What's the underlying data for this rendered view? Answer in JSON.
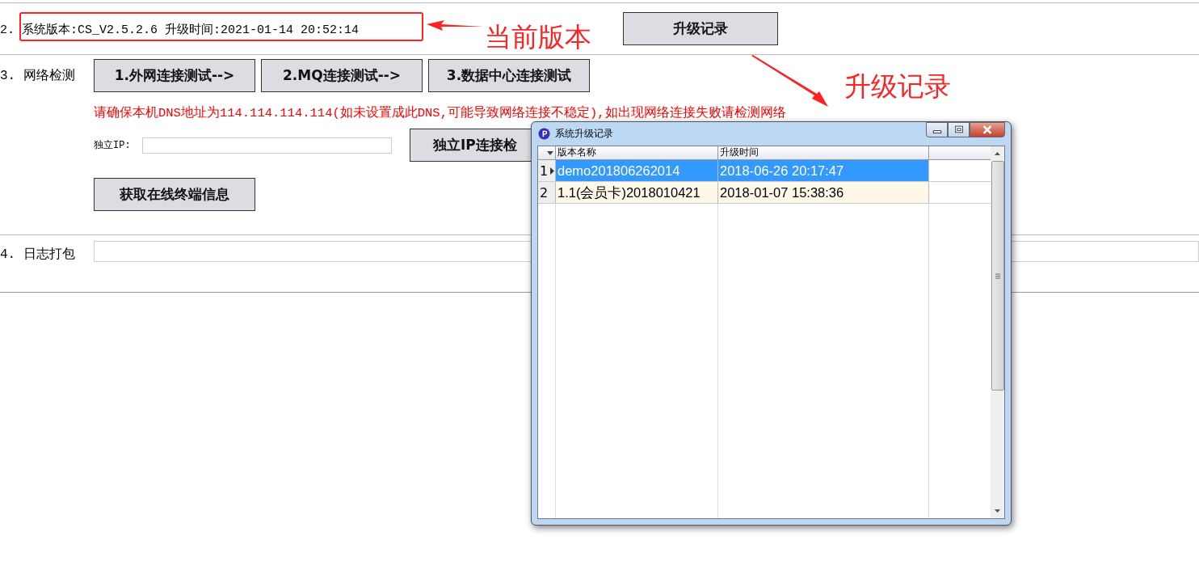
{
  "version_row": {
    "label": "2. 系统版本:CS_V2.5.2.6 升级时间:2021-01-14 20:52:14",
    "button": "升级记录"
  },
  "network": {
    "label": "3. 网络检测",
    "buttons": [
      "1.外网连接测试-->",
      "2.MQ连接测试-->",
      "3.数据中心连接测试"
    ],
    "notice": "请确保本机DNS地址为114.114.114.114(如未设置成此DNS,可能导致网络连接不稳定),如出现网络连接失败请检测网络",
    "ip_label": "独立IP:",
    "ip_button": "独立IP连接检",
    "terminal_button": "获取在线终端信息"
  },
  "log": {
    "label": "4. 日志打包"
  },
  "dialog": {
    "title": "系统升级记录",
    "columns": [
      "版本名称",
      "升级时间"
    ],
    "rows": [
      {
        "number": "1",
        "cells": [
          "demo201806262014",
          "2018-06-26 20:17:47"
        ],
        "selected": true
      },
      {
        "number": "2",
        "cells": [
          "1.1(会员卡)2018010421",
          "2018-01-07 15:38:36"
        ],
        "selected": false
      }
    ]
  },
  "annotations": [
    {
      "kind": "boxed-arrow",
      "text": "当前版本"
    },
    {
      "kind": "pointer-arrow",
      "text": "升级记录"
    }
  ]
}
